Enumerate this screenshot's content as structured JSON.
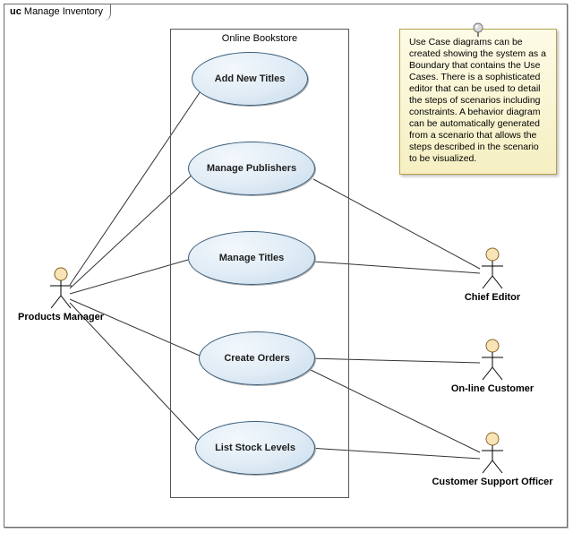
{
  "frame": {
    "prefix": "uc",
    "title": "Manage Inventory"
  },
  "boundary": {
    "title": "Online Bookstore"
  },
  "usecases": [
    {
      "id": "addNewTitles",
      "label": "Add New Titles"
    },
    {
      "id": "managePublishers",
      "label": "Manage Publishers"
    },
    {
      "id": "manageTitles",
      "label": "Manage Titles"
    },
    {
      "id": "createOrders",
      "label": "Create Orders"
    },
    {
      "id": "listStockLevels",
      "label": "List Stock Levels"
    }
  ],
  "actors": [
    {
      "id": "productsManager",
      "label": "Products Manager"
    },
    {
      "id": "chiefEditor",
      "label": "Chief Editor"
    },
    {
      "id": "onlineCustomer",
      "label": "On-line Customer"
    },
    {
      "id": "customerSupportOfficer",
      "label": "Customer Support Officer"
    }
  ],
  "note": {
    "text": "Use Case diagrams can be created showing the system as a Boundary that contains the Use Cases. There is a sophisticated editor that can be used to detail the steps of scenarios including constraints. A behavior diagram can be automatically generated from a scenario that allows the steps described in the scenario to be visualized."
  },
  "associations": [
    {
      "from": "productsManager",
      "to": "addNewTitles"
    },
    {
      "from": "productsManager",
      "to": "managePublishers"
    },
    {
      "from": "productsManager",
      "to": "manageTitles"
    },
    {
      "from": "productsManager",
      "to": "createOrders"
    },
    {
      "from": "productsManager",
      "to": "listStockLevels"
    },
    {
      "from": "chiefEditor",
      "to": "managePublishers"
    },
    {
      "from": "chiefEditor",
      "to": "manageTitles"
    },
    {
      "from": "onlineCustomer",
      "to": "createOrders"
    },
    {
      "from": "customerSupportOfficer",
      "to": "createOrders"
    },
    {
      "from": "customerSupportOfficer",
      "to": "listStockLevels"
    }
  ]
}
